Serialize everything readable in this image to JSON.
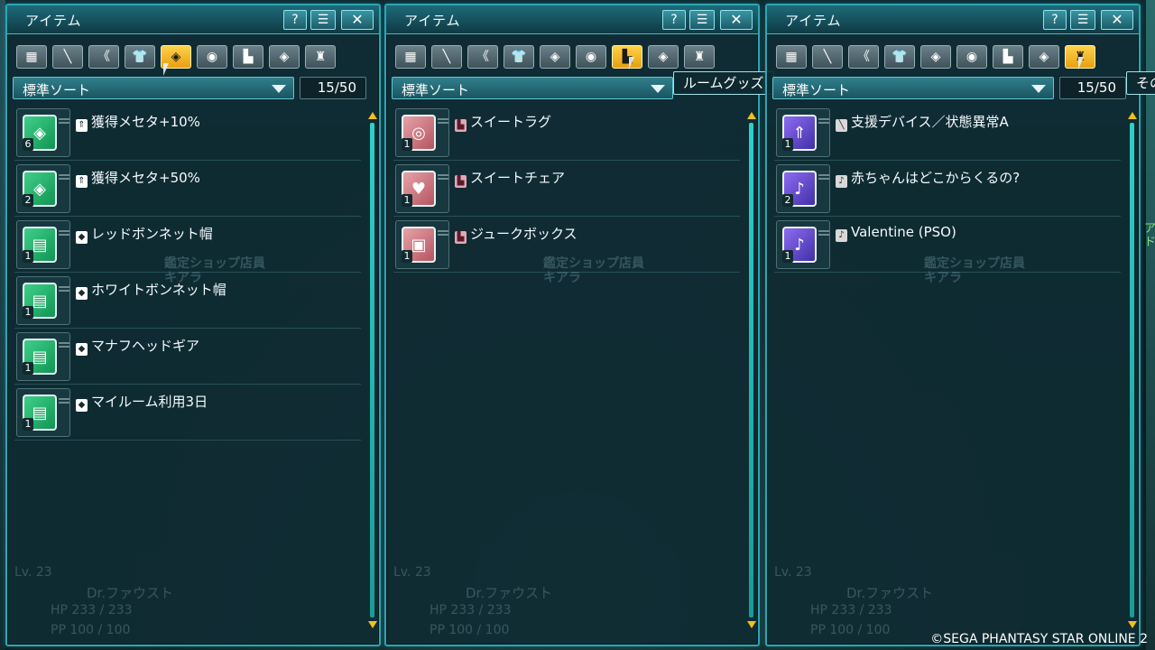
{
  "panels": [
    {
      "title": "アイテム",
      "help_label": "?",
      "close_label": "✕",
      "active_tab": 4,
      "sort_label": "標準ソート",
      "count": "15/50",
      "ghost_shop": [
        "鑑定ショップ店員",
        "キアラ"
      ],
      "ghost_status": {
        "lv": "Lv. 23",
        "name": "Dr.ファウスト",
        "hp": "HP 233 / 233",
        "pp": "PP 100 / 100"
      },
      "items": [
        {
          "name": "獲得メセタ+10%",
          "qty": "6",
          "color": "green",
          "glyph": "◈",
          "cat": "⇑"
        },
        {
          "name": "獲得メセタ+50%",
          "qty": "2",
          "color": "green",
          "glyph": "◈",
          "cat": "⇑"
        },
        {
          "name": "レッドボンネット帽",
          "qty": "1",
          "color": "green",
          "glyph": "▤",
          "cat": "◆"
        },
        {
          "name": "ホワイトボンネット帽",
          "qty": "1",
          "color": "green",
          "glyph": "▤",
          "cat": "◆"
        },
        {
          "name": "マナフヘッドギア",
          "qty": "1",
          "color": "green",
          "glyph": "▤",
          "cat": "◆"
        },
        {
          "name": "マイルーム利用3日",
          "qty": "1",
          "color": "green",
          "glyph": "▤",
          "cat": "◆"
        }
      ]
    },
    {
      "title": "アイテム",
      "help_label": "?",
      "close_label": "✕",
      "active_tab": 6,
      "sort_label": "標準ソート",
      "tooltip": "ルームグッズ",
      "ghost_shop": [
        "鑑定ショップ店員",
        "キアラ"
      ],
      "ghost_status": {
        "lv": "Lv. 23",
        "name": "Dr.ファウスト",
        "hp": "HP 233 / 233",
        "pp": "PP 100 / 100"
      },
      "items": [
        {
          "name": "スイートラグ",
          "qty": "1",
          "color": "pink",
          "glyph": "◎",
          "cat": "▙"
        },
        {
          "name": "スイートチェア",
          "qty": "1",
          "color": "pink",
          "glyph": "♥",
          "cat": "▙"
        },
        {
          "name": "ジュークボックス",
          "qty": "1",
          "color": "pink",
          "glyph": "▣",
          "cat": "▙"
        }
      ]
    },
    {
      "title": "アイテム",
      "help_label": "?",
      "close_label": "✕",
      "active_tab": 8,
      "sort_label": "標準ソート",
      "count": "15/50",
      "tooltip": "その",
      "ghost_shop": [
        "鑑定ショップ店員",
        "キアラ"
      ],
      "ghost_status": {
        "lv": "Lv. 23",
        "name": "Dr.ファウスト",
        "hp": "HP 233 / 233",
        "pp": "PP 100 / 100"
      },
      "items": [
        {
          "name": "支援デバイス／状態異常A",
          "qty": "1",
          "color": "purple",
          "glyph": "⇑",
          "cat": "╲"
        },
        {
          "name": "赤ちゃんはどこからくるの?",
          "qty": "2",
          "color": "purple",
          "glyph": "♪",
          "cat": "♪"
        },
        {
          "name": "Valentine (PSO)",
          "qty": "1",
          "color": "purple",
          "glyph": "♪",
          "cat": "♪"
        }
      ]
    }
  ],
  "tabs": [
    {
      "icon": "grid-icon",
      "glyph": "▦"
    },
    {
      "icon": "sword-icon",
      "glyph": "╲"
    },
    {
      "icon": "claws-icon",
      "glyph": "《"
    },
    {
      "icon": "shirt-icon",
      "glyph": "👕"
    },
    {
      "icon": "tag-icon",
      "glyph": "◈"
    },
    {
      "icon": "disc-icon",
      "glyph": "◉"
    },
    {
      "icon": "chair-icon",
      "glyph": "▙"
    },
    {
      "icon": "diamond-icon",
      "glyph": "◈"
    },
    {
      "icon": "bag-icon",
      "glyph": "♜"
    }
  ],
  "edge_text": "アド",
  "copyright": "©SEGA PHANTASY STAR ONLINE 2"
}
